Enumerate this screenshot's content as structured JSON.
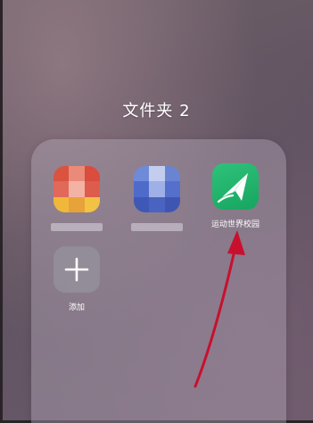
{
  "folder": {
    "title": "文件夹 2"
  },
  "apps": [
    {
      "name": "",
      "blurred": true
    },
    {
      "name": "",
      "blurred": true
    },
    {
      "name": "运动世界校园",
      "icon": "paper-plane-icon",
      "color": "#1fb46a"
    },
    {
      "name": "添加",
      "icon": "plus-icon"
    }
  ],
  "annotation": {
    "arrow_color": "#c8102e"
  }
}
